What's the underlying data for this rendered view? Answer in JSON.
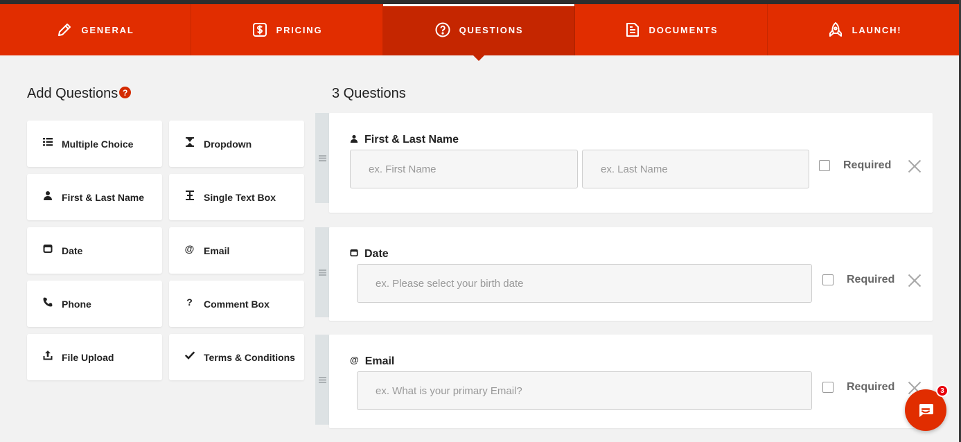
{
  "tabs": [
    {
      "label": "GENERAL",
      "icon": "pencil-icon"
    },
    {
      "label": "PRICING",
      "icon": "dollar-icon"
    },
    {
      "label": "QUESTIONS",
      "icon": "question-circle-icon",
      "active": true
    },
    {
      "label": "DOCUMENTS",
      "icon": "document-icon"
    },
    {
      "label": "LAUNCH!",
      "icon": "rocket-icon"
    }
  ],
  "left": {
    "title": "Add Questions",
    "help": "?",
    "buttons": [
      {
        "label": "Multiple Choice",
        "icon": "list-icon"
      },
      {
        "label": "Dropdown",
        "icon": "hourglass-icon"
      },
      {
        "label": "First & Last Name",
        "icon": "user-icon"
      },
      {
        "label": "Single Text Box",
        "icon": "text-cursor-icon"
      },
      {
        "label": "Date",
        "icon": "calendar-icon"
      },
      {
        "label": "Email",
        "icon": "at-icon"
      },
      {
        "label": "Phone",
        "icon": "phone-icon"
      },
      {
        "label": "Comment Box",
        "icon": "question-icon"
      },
      {
        "label": "File Upload",
        "icon": "upload-icon"
      },
      {
        "label": "Terms & Conditions",
        "icon": "check-icon"
      }
    ]
  },
  "right": {
    "title": "3 Questions",
    "questions": [
      {
        "label": "First & Last Name",
        "icon": "user-icon",
        "placeholders": [
          "ex. First Name",
          "ex. Last Name"
        ],
        "required_label": "Required",
        "required": false
      },
      {
        "label": "Date",
        "icon": "calendar-icon",
        "placeholders": [
          "ex. Please select your birth date"
        ],
        "required_label": "Required",
        "required": false
      },
      {
        "label": "Email",
        "icon": "at-icon",
        "placeholders": [
          "ex. What is your primary Email?"
        ],
        "required_label": "Required",
        "required": false
      }
    ]
  },
  "chat": {
    "badge": "3",
    "icon": "chat-icon"
  },
  "colors": {
    "accent": "#e12d00",
    "accent_active": "#c52600",
    "background": "#f2f2f2"
  }
}
